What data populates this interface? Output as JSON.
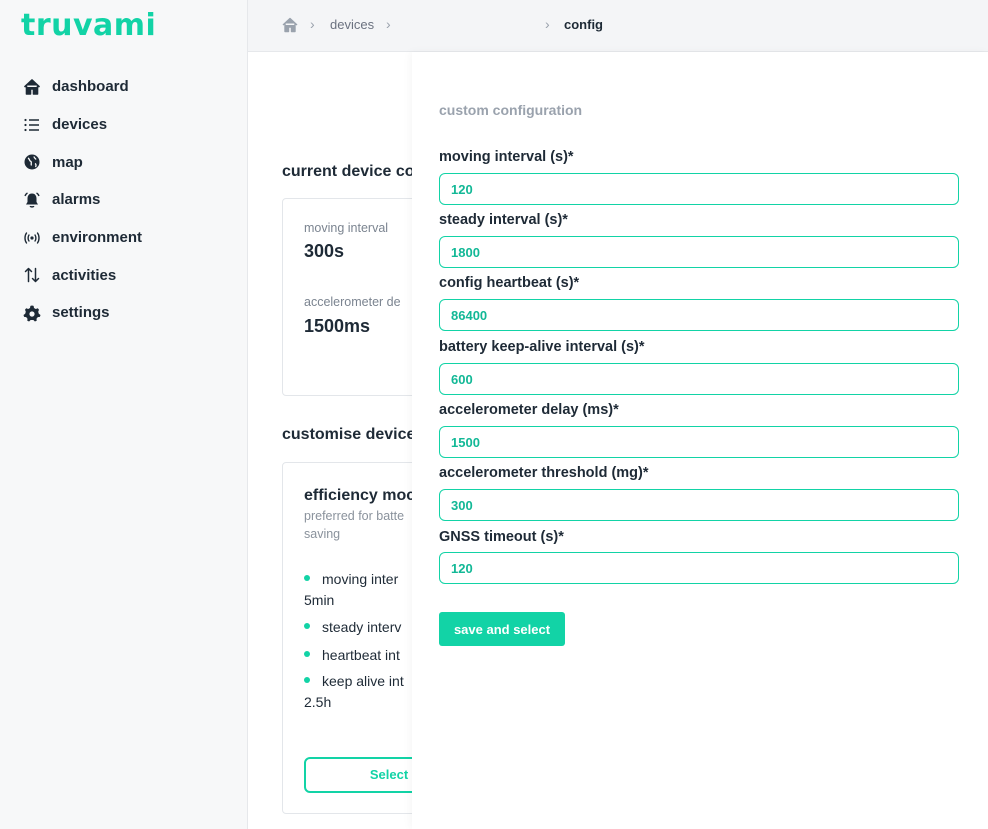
{
  "app": {
    "logo": "truvami",
    "accent_color": "#12d3a6"
  },
  "sidebar": {
    "items": [
      {
        "label": "dashboard",
        "icon": "home-icon"
      },
      {
        "label": "devices",
        "icon": "list-icon"
      },
      {
        "label": "map",
        "icon": "globe-icon"
      },
      {
        "label": "alarms",
        "icon": "bell-icon"
      },
      {
        "label": "environment",
        "icon": "broadcast-icon"
      },
      {
        "label": "activities",
        "icon": "arrows-up-down-icon"
      },
      {
        "label": "settings",
        "icon": "gear-icon"
      }
    ]
  },
  "breadcrumb": {
    "home_icon": "home-icon",
    "devices": "devices",
    "config": "config"
  },
  "current": {
    "title": "current device co",
    "moving_label": "moving interval",
    "moving_value": "300s",
    "accel_label": "accelerometer de",
    "accel_value": "1500ms"
  },
  "customise": {
    "title": "customise device",
    "mode_title": "efficiency moc",
    "mode_desc_line1": "preferred for batte",
    "mode_desc_line2": "saving",
    "bullets": [
      "moving inter",
      "steady interv",
      "heartbeat int",
      "keep alive int"
    ],
    "bullet1_cont": "5min",
    "bullet4_cont": "2.5h",
    "select_label": "Select"
  },
  "panel": {
    "title": "custom configuration",
    "fields": [
      {
        "label": "moving interval (s)*",
        "value": "120"
      },
      {
        "label": "steady interval (s)*",
        "value": "1800"
      },
      {
        "label": "config heartbeat (s)*",
        "value": "86400"
      },
      {
        "label": "battery keep-alive interval (s)*",
        "value": "600"
      },
      {
        "label": "accelerometer delay (ms)*",
        "value": "1500"
      },
      {
        "label": "accelerometer threshold (mg)*",
        "value": "300"
      },
      {
        "label": "GNSS timeout (s)*",
        "value": "120"
      }
    ],
    "save_label": "save and select"
  }
}
